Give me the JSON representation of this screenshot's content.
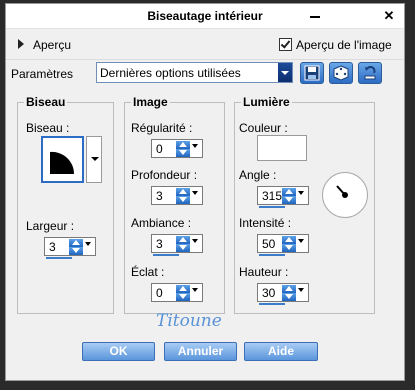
{
  "window": {
    "title": "Biseautage intérieur"
  },
  "preview": {
    "toggle_label": "Aperçu",
    "checkbox_label": "Aperçu de l'image",
    "checked": true
  },
  "presets": {
    "label": "Paramètres",
    "selected": "Dernières options utilisées"
  },
  "toolbar": {
    "save_icon": "save-icon",
    "random_icon": "dice-icon",
    "reset_icon": "reset-icon"
  },
  "biseau": {
    "title": "Biseau",
    "bevel_label": "Biseau :",
    "width_label": "Largeur :",
    "width_value": "3"
  },
  "image": {
    "title": "Image",
    "smoothness_label": "Régularité :",
    "smoothness_value": "0",
    "depth_label": "Profondeur :",
    "depth_value": "3",
    "ambience_label": "Ambiance :",
    "ambience_value": "3",
    "shininess_label": "Éclat :",
    "shininess_value": "0"
  },
  "lumiere": {
    "title": "Lumière",
    "color_label": "Couleur :",
    "color_value": "#ffffff",
    "angle_label": "Angle :",
    "angle_value": "315",
    "intensity_label": "Intensité :",
    "intensity_value": "50",
    "height_label": "Hauteur :",
    "height_value": "30"
  },
  "watermark": "Titoune",
  "buttons": {
    "ok": "OK",
    "cancel": "Annuler",
    "help": "Aide"
  },
  "colors": {
    "accent": "#2c6cc4",
    "button": "#5b95dc"
  }
}
